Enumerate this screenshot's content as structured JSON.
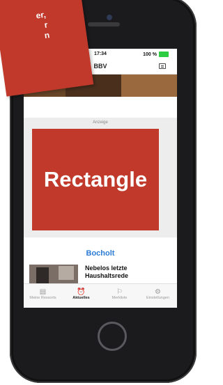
{
  "callout": {
    "lines": [
      "er,",
      "r",
      "n"
    ]
  },
  "status": {
    "time": "17:34",
    "battery": "100 %"
  },
  "nav": {
    "title": "BBV",
    "icon": "newspaper-icon"
  },
  "ad": {
    "label": "Anzeige",
    "placeholder": "Rectangle"
  },
  "section": {
    "title": "Bocholt"
  },
  "news": [
    {
      "title": "Nebelos letzte Haushaltsrede"
    }
  ],
  "tabs": [
    {
      "label": "Meine Ressorts",
      "icon": "resorts-icon",
      "active": false
    },
    {
      "label": "Aktuelles",
      "icon": "alarm-clock-icon",
      "active": true
    },
    {
      "label": "Merkliste",
      "icon": "bookmark-icon",
      "active": false
    },
    {
      "label": "Einstellungen",
      "icon": "gear-icon",
      "active": false
    }
  ],
  "colors": {
    "accent": "#2b7bd6",
    "ad_red": "#c0392b",
    "battery": "#2ecc40"
  }
}
